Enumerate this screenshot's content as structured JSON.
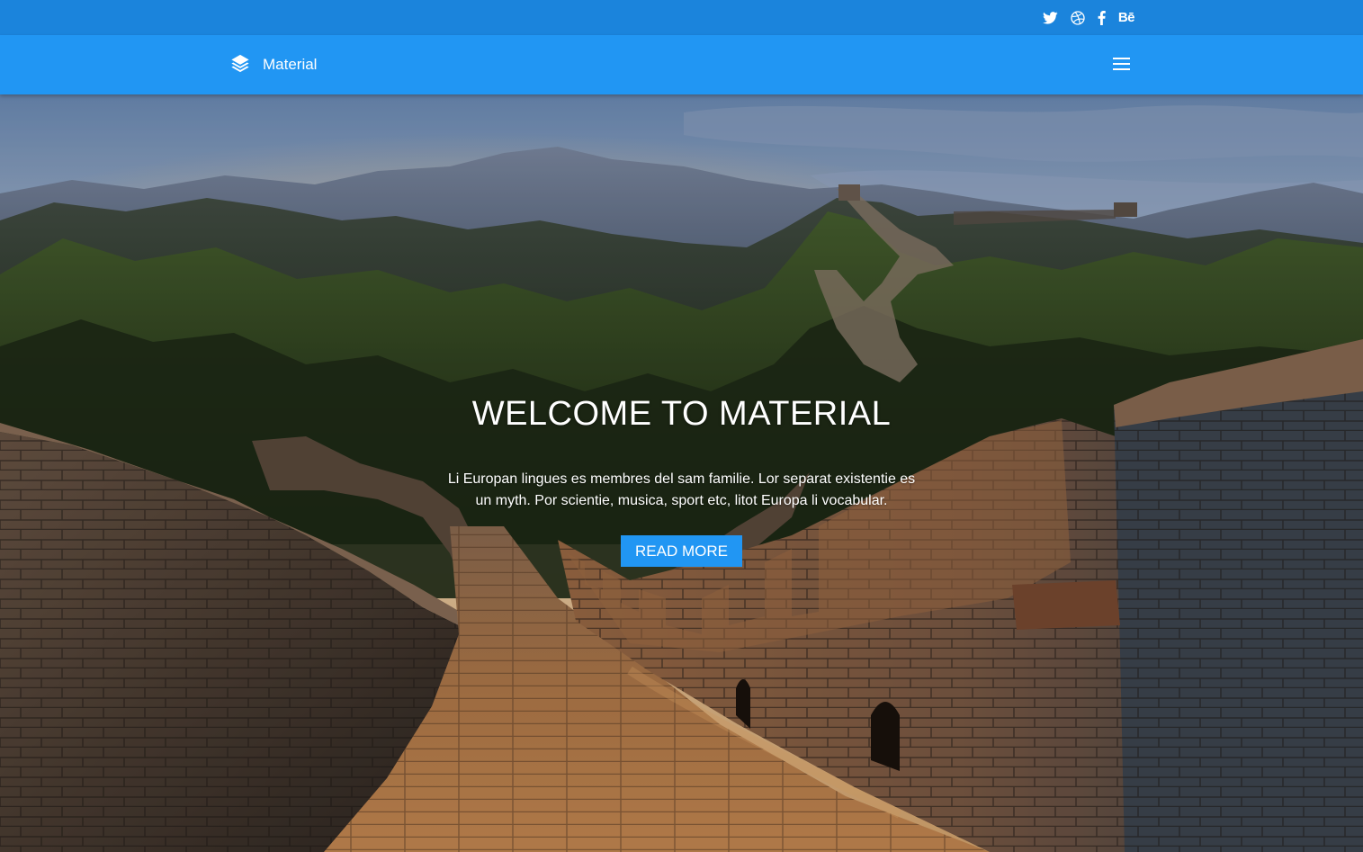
{
  "social": [
    {
      "name": "twitter",
      "icon": "twitter-icon"
    },
    {
      "name": "dribbble",
      "icon": "dribbble-icon"
    },
    {
      "name": "facebook",
      "icon": "facebook-icon"
    },
    {
      "name": "behance",
      "icon": "behance-icon",
      "glyph": "Bē"
    }
  ],
  "brand": {
    "icon": "layers-icon",
    "name": "Material"
  },
  "nav": {
    "menu_icon": "hamburger-menu-icon"
  },
  "hero": {
    "title": "WELCOME TO MATERIAL",
    "text": "Li Europan lingues es membres del sam familie. Lor separat existentie es un myth. Por scientie, musica, sport etc, litot Europa li vocabular.",
    "button_label": "READ MORE",
    "background": "great-wall-photo"
  },
  "colors": {
    "topbar": "#1b84dc",
    "navbar": "#2196f3",
    "accent": "#2196f3",
    "text_on_primary": "#ffffff"
  }
}
